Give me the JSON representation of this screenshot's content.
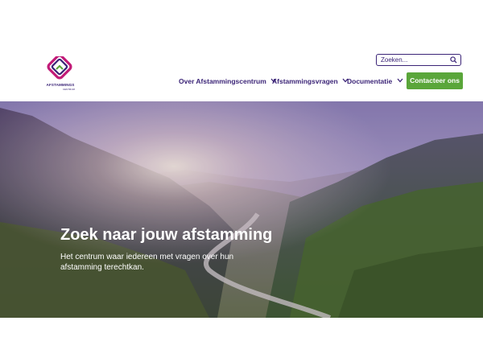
{
  "brand": {
    "name": "AFSTAMMINGS",
    "sub": "CENTRUM",
    "colors": {
      "purple": "#3b2477",
      "magenta": "#c21b78",
      "green": "#5aa63a"
    }
  },
  "search": {
    "placeholder": "Zoeken...",
    "icon": "search-icon"
  },
  "nav": {
    "items": [
      {
        "label": "Over Afstammingscentrum"
      },
      {
        "label": "Afstammingsvragen"
      },
      {
        "label": "Documentatie"
      }
    ],
    "cta_label": "Contacteer ons"
  },
  "hero": {
    "title": "Zoek naar jouw afstamming",
    "subtitle": "Het centrum waar iedereen met vragen over hun afstamming terechtkan."
  }
}
